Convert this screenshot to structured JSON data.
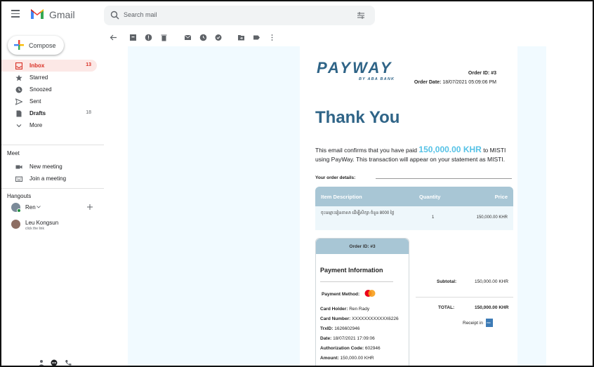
{
  "app": {
    "name": "Gmail"
  },
  "search": {
    "placeholder": "Search mail"
  },
  "compose": {
    "label": "Compose"
  },
  "nav": [
    {
      "label": "Inbox",
      "count": "13",
      "icon": "inbox-icon",
      "active": true
    },
    {
      "label": "Starred",
      "count": "",
      "icon": "star-icon"
    },
    {
      "label": "Snoozed",
      "count": "",
      "icon": "clock-icon"
    },
    {
      "label": "Sent",
      "count": "",
      "icon": "send-icon"
    },
    {
      "label": "Drafts",
      "count": "18",
      "icon": "draft-icon"
    },
    {
      "label": "More",
      "count": "",
      "icon": "chevron-down-icon"
    }
  ],
  "meet": {
    "title": "Meet",
    "items": [
      {
        "label": "New meeting",
        "icon": "video-icon"
      },
      {
        "label": "Join a meeting",
        "icon": "keyboard-icon"
      }
    ]
  },
  "hangouts": {
    "title": "Hangouts",
    "user": "Ren",
    "contacts": [
      {
        "name": "Leu Kongsun",
        "status": "click the link"
      }
    ]
  },
  "email": {
    "logo_text": "PAYWAY",
    "logo_sub": "BY ABA BANK",
    "order_id_label": "Order ID: #3",
    "order_date_label": "Order Date:",
    "order_date": "18/07/2021 05:09:06 PM",
    "heading": "Thank You",
    "confirm_pre": "This email confirms that you have paid",
    "confirm_amount": "150,000.00 KHR",
    "confirm_post": "to MISTI using PayWay. This transaction will appear on your statement as MISTI.",
    "order_details_label": "Your order details:",
    "table": {
      "headers": [
        "Item Description",
        "Quantity",
        "Price"
      ],
      "rows": [
        {
          "item": "ចុះឈ្មោះរៀនភាសា ដើម្បីសិក្សា  ចំនួន  8000 ថ្ងៃ",
          "qty": "1",
          "price": "150,000.00 KHR"
        }
      ]
    },
    "card_order_id": "Order ID: #3",
    "payment_info_title": "Payment Information",
    "payment_method_label": "Payment Method:",
    "card_holder_label": "Card Holder:",
    "card_holder": "Ren Rady",
    "card_number_label": "Card Number:",
    "card_number": "XXXXXXXXXXXX6226",
    "trxid_label": "TrxID:",
    "trxid": "1626602946",
    "date_label": "Date:",
    "date": "18/07/2021 17:09:06",
    "auth_label": "Authorization Code:",
    "auth": "602946",
    "amount_label": "Amount:",
    "amount": "150,000.00 KHR",
    "subtotal_label": "Subtotal:",
    "subtotal": "150,000.00 KHR",
    "total_label": "TOTAL:",
    "total": "150,000.00 KHR",
    "receipt_label": "Receipt in",
    "pdf_label": "PDF"
  }
}
